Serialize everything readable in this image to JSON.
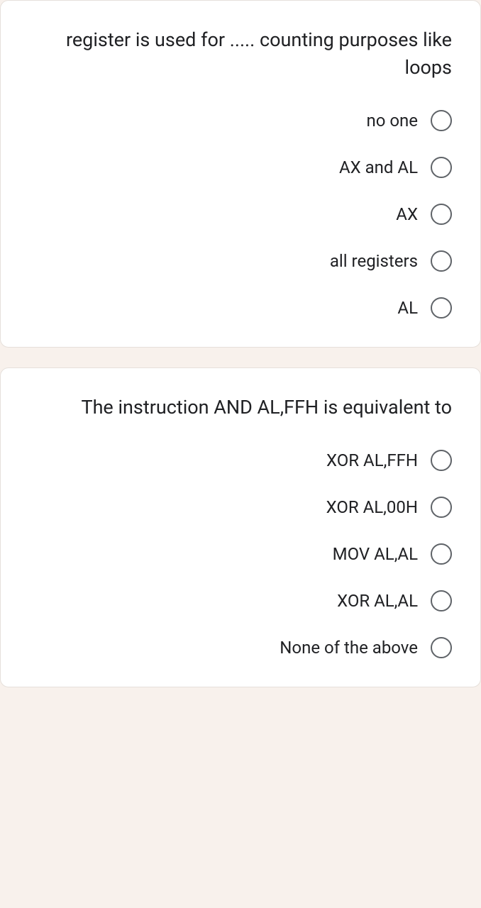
{
  "questions": [
    {
      "prompt": "register  is used for ..... counting purposes like loops",
      "options": [
        {
          "label": "no one"
        },
        {
          "label": "AX and AL"
        },
        {
          "label": "AX"
        },
        {
          "label": "all registers"
        },
        {
          "label": "AL"
        }
      ]
    },
    {
      "prompt": "The instruction AND AL,FFH is equivalent to",
      "options": [
        {
          "label": "XOR AL,FFH"
        },
        {
          "label": "XOR AL,00H"
        },
        {
          "label": "MOV AL,AL"
        },
        {
          "label": "XOR AL,AL"
        },
        {
          "label": "None of the above"
        }
      ]
    }
  ]
}
